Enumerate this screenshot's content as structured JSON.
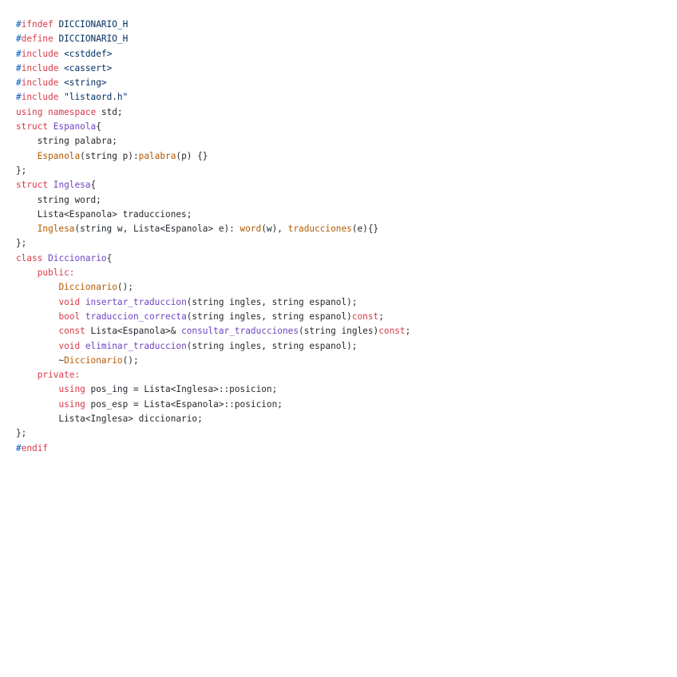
{
  "editor": {
    "lines": [
      [
        {
          "t": "#",
          "c": "hash"
        },
        {
          "t": "ifndef",
          "c": "keyword"
        },
        {
          "t": " DICCIONARIO_H",
          "c": "macro"
        }
      ],
      [
        {
          "t": "#",
          "c": "hash"
        },
        {
          "t": "define",
          "c": "keyword"
        },
        {
          "t": " DICCIONARIO_H",
          "c": "macro"
        }
      ],
      [
        {
          "t": "#",
          "c": "hash"
        },
        {
          "t": "include",
          "c": "keyword"
        },
        {
          "t": " <cstddef>",
          "c": "string"
        }
      ],
      [
        {
          "t": "#",
          "c": "hash"
        },
        {
          "t": "include",
          "c": "keyword"
        },
        {
          "t": " <cassert>",
          "c": "string"
        }
      ],
      [
        {
          "t": "#",
          "c": "hash"
        },
        {
          "t": "include",
          "c": "keyword"
        },
        {
          "t": " <string>",
          "c": "string"
        }
      ],
      [
        {
          "t": "#",
          "c": "hash"
        },
        {
          "t": "include",
          "c": "keyword"
        },
        {
          "t": " \"listaord.h\"",
          "c": "string"
        }
      ],
      [
        {
          "t": "using",
          "c": "keyword"
        },
        {
          "t": " ",
          "c": "plain"
        },
        {
          "t": "namespace",
          "c": "keyword"
        },
        {
          "t": " std;",
          "c": "plain"
        }
      ],
      [
        {
          "t": "struct",
          "c": "keyword"
        },
        {
          "t": " ",
          "c": "plain"
        },
        {
          "t": "Espanola",
          "c": "type"
        },
        {
          "t": "{",
          "c": "plain"
        }
      ],
      [
        {
          "t": "    string palabra;",
          "c": "plain"
        }
      ],
      [
        {
          "t": "    ",
          "c": "plain"
        },
        {
          "t": "Espanola",
          "c": "call"
        },
        {
          "t": "(string p):",
          "c": "plain"
        },
        {
          "t": "palabra",
          "c": "call"
        },
        {
          "t": "(p) {}",
          "c": "plain"
        }
      ],
      [
        {
          "t": "};",
          "c": "plain"
        }
      ],
      [
        {
          "t": "struct",
          "c": "keyword"
        },
        {
          "t": " ",
          "c": "plain"
        },
        {
          "t": "Inglesa",
          "c": "type"
        },
        {
          "t": "{",
          "c": "plain"
        }
      ],
      [
        {
          "t": "    string word;",
          "c": "plain"
        }
      ],
      [
        {
          "t": "    Lista<Espanola> traducciones;",
          "c": "plain"
        }
      ],
      [
        {
          "t": "    ",
          "c": "plain"
        },
        {
          "t": "Inglesa",
          "c": "call"
        },
        {
          "t": "(string w, Lista<Espanola> e): ",
          "c": "plain"
        },
        {
          "t": "word",
          "c": "call"
        },
        {
          "t": "(w), ",
          "c": "plain"
        },
        {
          "t": "traducciones",
          "c": "call"
        },
        {
          "t": "(e){}",
          "c": "plain"
        }
      ],
      [
        {
          "t": "};",
          "c": "plain"
        }
      ],
      [
        {
          "t": "class",
          "c": "keyword"
        },
        {
          "t": " ",
          "c": "plain"
        },
        {
          "t": "Diccionario",
          "c": "type"
        },
        {
          "t": "{",
          "c": "plain"
        }
      ],
      [
        {
          "t": "    ",
          "c": "plain"
        },
        {
          "t": "public:",
          "c": "keyword"
        }
      ],
      [
        {
          "t": "        ",
          "c": "plain"
        },
        {
          "t": "Diccionario",
          "c": "call"
        },
        {
          "t": "();",
          "c": "plain"
        }
      ],
      [
        {
          "t": "        ",
          "c": "plain"
        },
        {
          "t": "void",
          "c": "keyword"
        },
        {
          "t": " ",
          "c": "plain"
        },
        {
          "t": "insertar_traduccion",
          "c": "type"
        },
        {
          "t": "(string ingles, string espanol);",
          "c": "plain"
        }
      ],
      [
        {
          "t": "        ",
          "c": "plain"
        },
        {
          "t": "bool",
          "c": "keyword"
        },
        {
          "t": " ",
          "c": "plain"
        },
        {
          "t": "traduccion_correcta",
          "c": "type"
        },
        {
          "t": "(string ingles, string espanol)",
          "c": "plain"
        },
        {
          "t": "const",
          "c": "keyword"
        },
        {
          "t": ";",
          "c": "plain"
        }
      ],
      [
        {
          "t": "        ",
          "c": "plain"
        },
        {
          "t": "const",
          "c": "keyword"
        },
        {
          "t": " Lista<Espanola>& ",
          "c": "plain"
        },
        {
          "t": "consultar_traducciones",
          "c": "type"
        },
        {
          "t": "(string ingles)",
          "c": "plain"
        },
        {
          "t": "const",
          "c": "keyword"
        },
        {
          "t": ";",
          "c": "plain"
        }
      ],
      [
        {
          "t": "        ",
          "c": "plain"
        },
        {
          "t": "void",
          "c": "keyword"
        },
        {
          "t": " ",
          "c": "plain"
        },
        {
          "t": "eliminar_traduccion",
          "c": "type"
        },
        {
          "t": "(string ingles, string espanol);",
          "c": "plain"
        }
      ],
      [
        {
          "t": "        ~",
          "c": "plain"
        },
        {
          "t": "Diccionario",
          "c": "call"
        },
        {
          "t": "();",
          "c": "plain"
        }
      ],
      [
        {
          "t": "    ",
          "c": "plain"
        },
        {
          "t": "private:",
          "c": "keyword"
        }
      ],
      [
        {
          "t": "        ",
          "c": "plain"
        },
        {
          "t": "using",
          "c": "keyword"
        },
        {
          "t": " pos_ing = Lista<Inglesa>::posicion;",
          "c": "plain"
        }
      ],
      [
        {
          "t": "        ",
          "c": "plain"
        },
        {
          "t": "using",
          "c": "keyword"
        },
        {
          "t": " pos_esp = Lista<Espanola>::posicion;",
          "c": "plain"
        }
      ],
      [
        {
          "t": "        Lista<Inglesa> diccionario;",
          "c": "plain"
        }
      ],
      [
        {
          "t": "};",
          "c": "plain"
        }
      ],
      [
        {
          "t": "#",
          "c": "hash"
        },
        {
          "t": "endif",
          "c": "keyword"
        }
      ]
    ],
    "colors": {
      "background": "#ffffff",
      "hash": "#005cc5",
      "keyword": "#d73a49",
      "macro": "#032f62",
      "string": "#032f62",
      "type": "#6f42c1",
      "call": "#b35900",
      "plain": "#24292e"
    }
  }
}
